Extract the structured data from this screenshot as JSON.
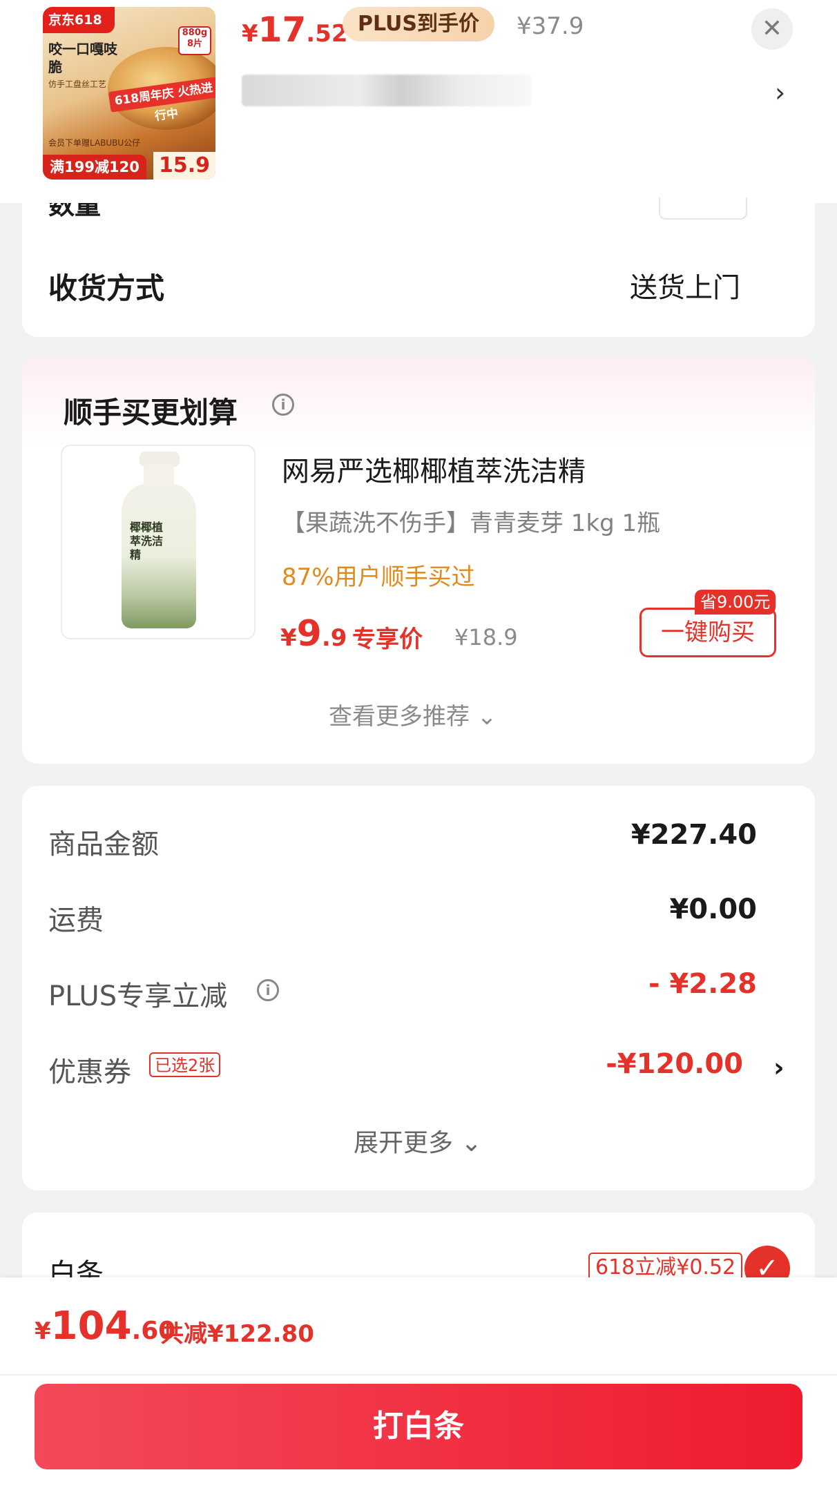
{
  "product": {
    "thumb": {
      "brand": "京东618",
      "slogan": "咬一口嘎吱脆",
      "feature": "仿手工盘丝工艺",
      "weight": "880g 8片",
      "banner": "618周年庆 火热进行中",
      "gift": "会员下单赠LABUBU公仔",
      "promo": "满199减120",
      "promo_price": "15.9"
    },
    "price_currency": "¥",
    "price_int": "17",
    "price_dec": ".52",
    "plus_label": "PLUS到手价",
    "original_price": "¥37.9",
    "close_symbol": "✕",
    "chevron": "›"
  },
  "order": {
    "quantity_label": "数量",
    "delivery_label": "收货方式",
    "delivery_value": "送货上门"
  },
  "recommendation": {
    "title": "顺手买更划算",
    "info_symbol": "i",
    "item": {
      "image_text": "椰椰植萃洗洁精",
      "name": "网易严选椰椰植萃洗洁精",
      "spec": "【果蔬洗不伤手】青青麦芽 1kg 1瓶",
      "social_proof": "87%用户顺手买过",
      "price_currency": "¥",
      "price_int": "9",
      "price_dec": ".9",
      "exclusive_label": "专享价",
      "original_price": "¥18.9",
      "buy_label": "一键购买",
      "save_tag": "省9.00元"
    },
    "more_label": "查看更多推荐 ⌄"
  },
  "summary": {
    "rows": [
      {
        "label": "商品金额",
        "value": "¥227.40"
      },
      {
        "label": "运费",
        "value": "¥0.00"
      },
      {
        "label": "PLUS专享立减",
        "value": "- ¥2.28"
      },
      {
        "label": "优惠券",
        "value": "-¥120.00"
      }
    ],
    "coupon_badge": "已选2张",
    "expand_label": "展开更多 ⌄",
    "chevron": "›"
  },
  "payment": {
    "label": "白条",
    "discount": "618立减¥0.52",
    "check_symbol": "✓"
  },
  "checkout": {
    "total_currency": "¥",
    "total_int": "104",
    "total_dec": ".60",
    "total_saved": "共减¥122.80",
    "button_label": "打白条"
  },
  "colors": {
    "accent_red": "#e4322a",
    "social_orange": "#e08a1e",
    "muted_gray": "#8a8a8a"
  }
}
